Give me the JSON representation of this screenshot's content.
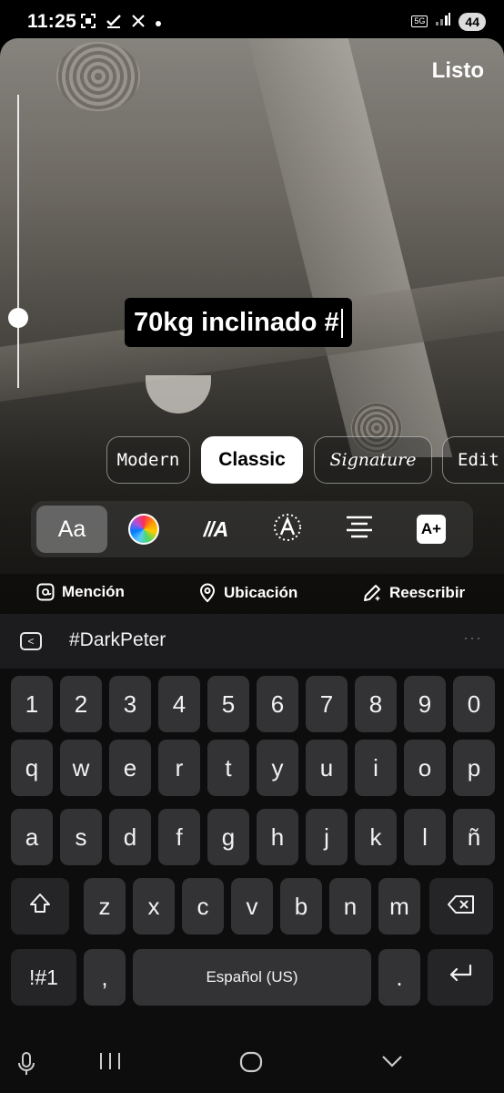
{
  "status_bar": {
    "time": "11:25",
    "left_icons": [
      "screenshot-icon",
      "check-icon",
      "x-app-icon",
      "dot-icon"
    ],
    "network": "5G",
    "battery": "44"
  },
  "editor": {
    "done_label": "Listo",
    "text_content": "70kg inclinado #",
    "font_styles": [
      {
        "label": "Modern",
        "active": false
      },
      {
        "label": "Classic",
        "active": true
      },
      {
        "label": "Signature",
        "active": false
      },
      {
        "label": "Edit",
        "active": false
      }
    ],
    "tools": [
      {
        "name": "font-style",
        "label": "Aa",
        "active": true
      },
      {
        "name": "color",
        "label": "",
        "active": false
      },
      {
        "name": "animation",
        "label": "//A",
        "active": false
      },
      {
        "name": "effect",
        "label": "A",
        "active": false
      },
      {
        "name": "alignment",
        "label": "",
        "active": false
      },
      {
        "name": "ai-text",
        "label": "A+",
        "active": false
      }
    ],
    "actions": {
      "mention": "Mención",
      "location": "Ubicación",
      "rewrite": "Reescribir"
    }
  },
  "suggestion_bar": {
    "suggestion": "#DarkPeter",
    "more": "···"
  },
  "keyboard": {
    "rows": [
      [
        "1",
        "2",
        "3",
        "4",
        "5",
        "6",
        "7",
        "8",
        "9",
        "0"
      ],
      [
        "q",
        "w",
        "e",
        "r",
        "t",
        "y",
        "u",
        "i",
        "o",
        "p"
      ],
      [
        "a",
        "s",
        "d",
        "f",
        "g",
        "h",
        "j",
        "k",
        "l",
        "ñ"
      ],
      [
        "z",
        "x",
        "c",
        "v",
        "b",
        "n",
        "m"
      ]
    ],
    "symbols_key": "!#1",
    "comma_key": ",",
    "space_label": "Español (US)",
    "period_key": "."
  },
  "colors": {
    "keyboard_bg": "#0d0d0d",
    "key_bg": "#333335",
    "accent_white": "#ffffff"
  }
}
